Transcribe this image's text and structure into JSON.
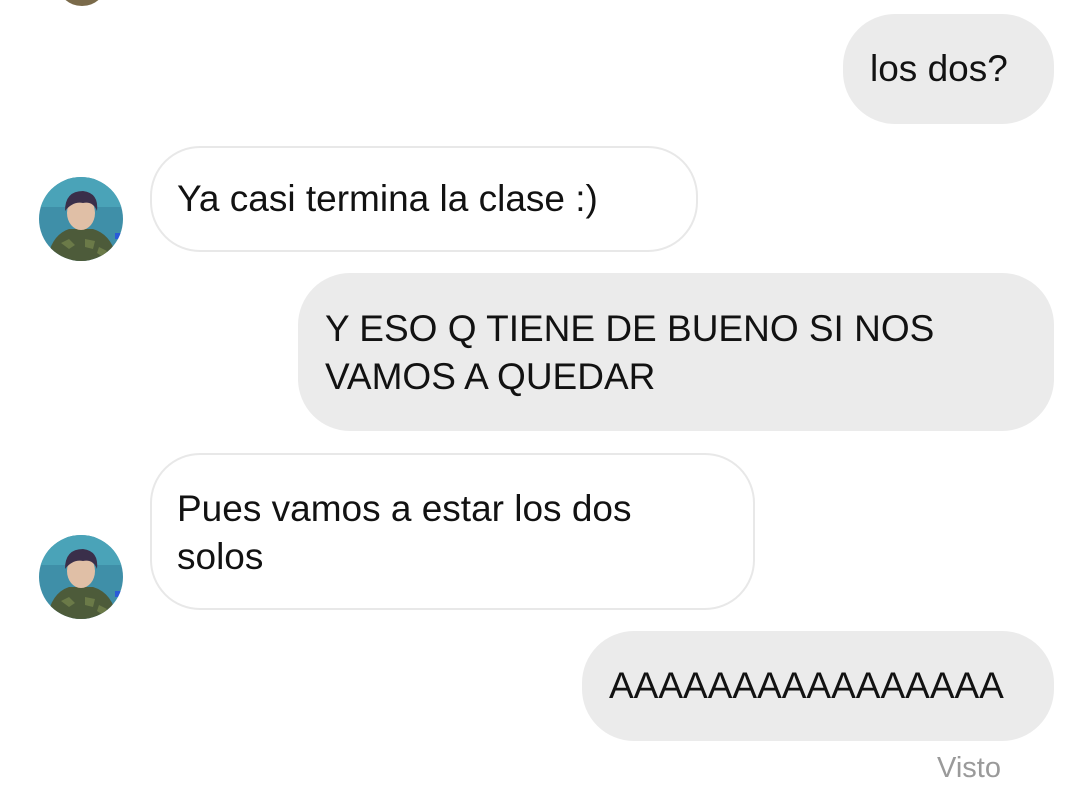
{
  "messages": [
    {
      "sender": "me",
      "text": "los dos?"
    },
    {
      "sender": "them",
      "text": "Ya casi termina la clase :)"
    },
    {
      "sender": "me",
      "text": "Y ESO Q TIENE DE BUENO SI NOS VAMOS A QUEDAR"
    },
    {
      "sender": "them",
      "text": "Pues vamos a estar los dos solos"
    },
    {
      "sender": "me",
      "text": "AAAAAAAAAAAAAAAA"
    }
  ],
  "status": {
    "seen_label": "Visto"
  },
  "avatar": {
    "icon": "contact-avatar-photo"
  },
  "colors": {
    "sent_bubble": "#ebebeb",
    "received_border": "#e8e8e8",
    "text": "#121212",
    "seen_text": "#9a9a9a"
  }
}
